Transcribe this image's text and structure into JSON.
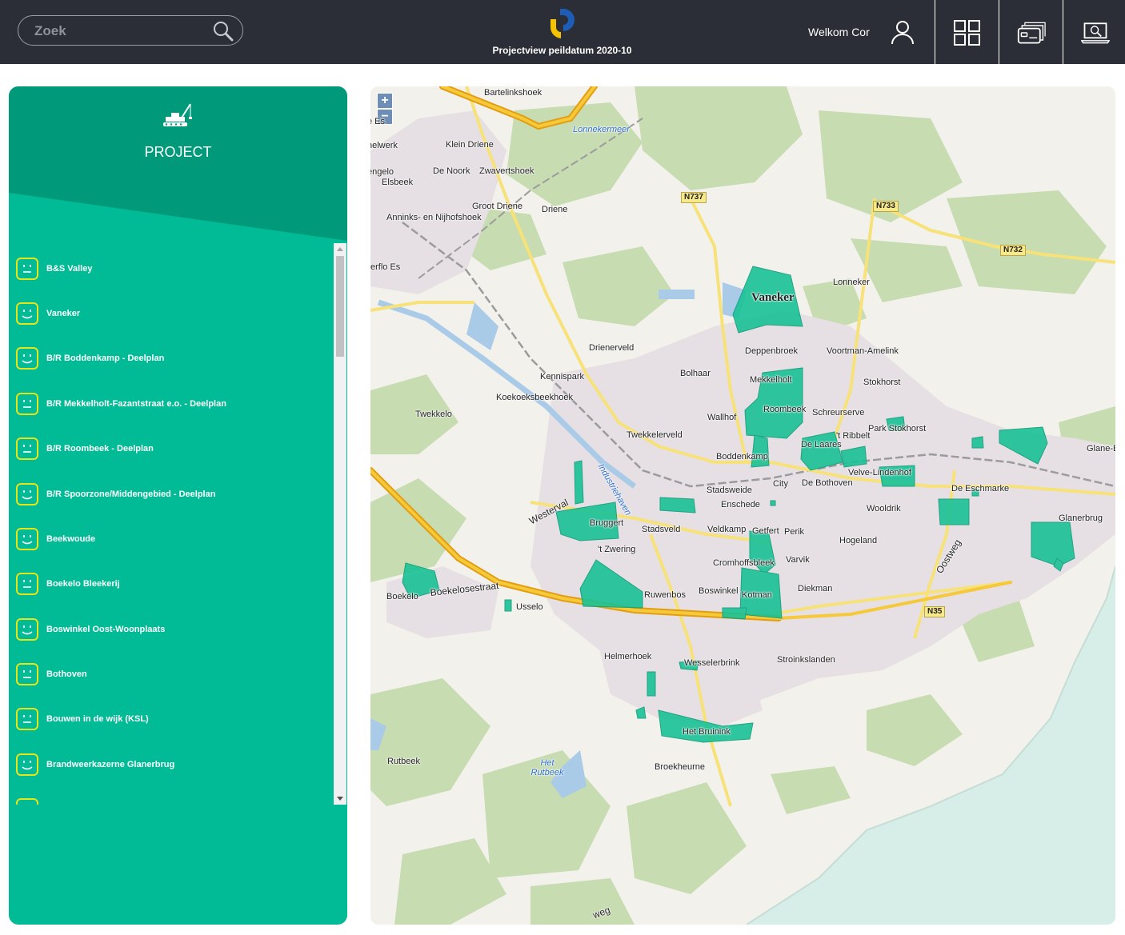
{
  "header": {
    "search_placeholder": "Zoek",
    "subtitle": "Projectview peildatum 2020-10",
    "welcome": "Welkom Cor",
    "icons": [
      "search-icon",
      "logo",
      "user-icon",
      "dashboard-grid-icon",
      "cards-icon",
      "laptop-search-icon"
    ]
  },
  "panel": {
    "title": "PROJECT",
    "icon": "crane-icon",
    "items": [
      {
        "label": "B&S Valley",
        "face": "neutral"
      },
      {
        "label": "Vaneker",
        "face": "happy"
      },
      {
        "label": "B/R Boddenkamp - Deelplan",
        "face": "happy"
      },
      {
        "label": "B/R Mekkelholt-Fazantstraat e.o. - Deelplan",
        "face": "neutral"
      },
      {
        "label": "B/R Roombeek - Deelplan",
        "face": "neutral"
      },
      {
        "label": "B/R Spoorzone/Middengebied - Deelplan",
        "face": "happy"
      },
      {
        "label": "Beekwoude",
        "face": "happy"
      },
      {
        "label": "Boekelo Bleekerij",
        "face": "neutral"
      },
      {
        "label": "Boswinkel Oost-Woonplaats",
        "face": "happy"
      },
      {
        "label": "Bothoven",
        "face": "neutral"
      },
      {
        "label": "Bouwen in de wijk (KSL)",
        "face": "neutral"
      },
      {
        "label": "Brandweerkazerne Glanerbrug",
        "face": "happy"
      }
    ]
  },
  "map": {
    "zoom_in": "+",
    "zoom_out": "−",
    "places": [
      "Bartelinkshoek",
      "Klein Driene",
      "De Noork",
      "Zwavertshoek",
      "Elsbeek",
      "Groot Driene",
      "Driene",
      "Anninks- en Nijhofshoek",
      "erflo Es",
      "Lonneker",
      "Drienerveld",
      "Kennispark",
      "Koekoeksbeekhoek",
      "Bolhaar",
      "Mekkelholt",
      "Deppenbroek",
      "Voortman-Amelink",
      "Stokhorst",
      "Twekkelo",
      "Wallhof",
      "Roombeek",
      "Schreurserve",
      "Park Stokhorst",
      "'t Ribbelt",
      "Twekkelerveld",
      "De Laares",
      "Boddenkamp",
      "Glane-B",
      "Stadsweide",
      "City",
      "De Bothoven",
      "Velve-Lindenhof",
      "De Eschmarke",
      "Enschede",
      "Wooldrik",
      "Bruggert",
      "Stadsveld",
      "Veldkamp",
      "Getfert",
      "Perik",
      "Hogeland",
      "Glanerbrug",
      "'t Zwering",
      "Cromhoffsbleek",
      "Varvik",
      "Ruwenbos",
      "Boswinkel",
      "Kotman",
      "Diekman",
      "Boekelo",
      "Usselo",
      "Helmerhoek",
      "Wesselerbrink",
      "Stroinkslanden",
      "Het Bruinink",
      "Rutbeek",
      "Broekheurne",
      "helwerk",
      "engelo",
      "e Es"
    ],
    "highlight_label": "Vaneker",
    "water_labels": [
      "Lonnekermeer",
      "Het Rutbeek",
      "Industriehaven"
    ],
    "road_labels": [
      "Westerval",
      "Boekelosestraat",
      "Oostweg",
      "weg"
    ],
    "shields": [
      "N737",
      "N733",
      "N732",
      "N35"
    ]
  },
  "colors": {
    "topbar": "#2b2e36",
    "panel": "#00bb95",
    "panel_head": "#009a7b",
    "face_yellow": "#e8e516",
    "project_area": "#19c296",
    "highway": "#f2b414"
  }
}
